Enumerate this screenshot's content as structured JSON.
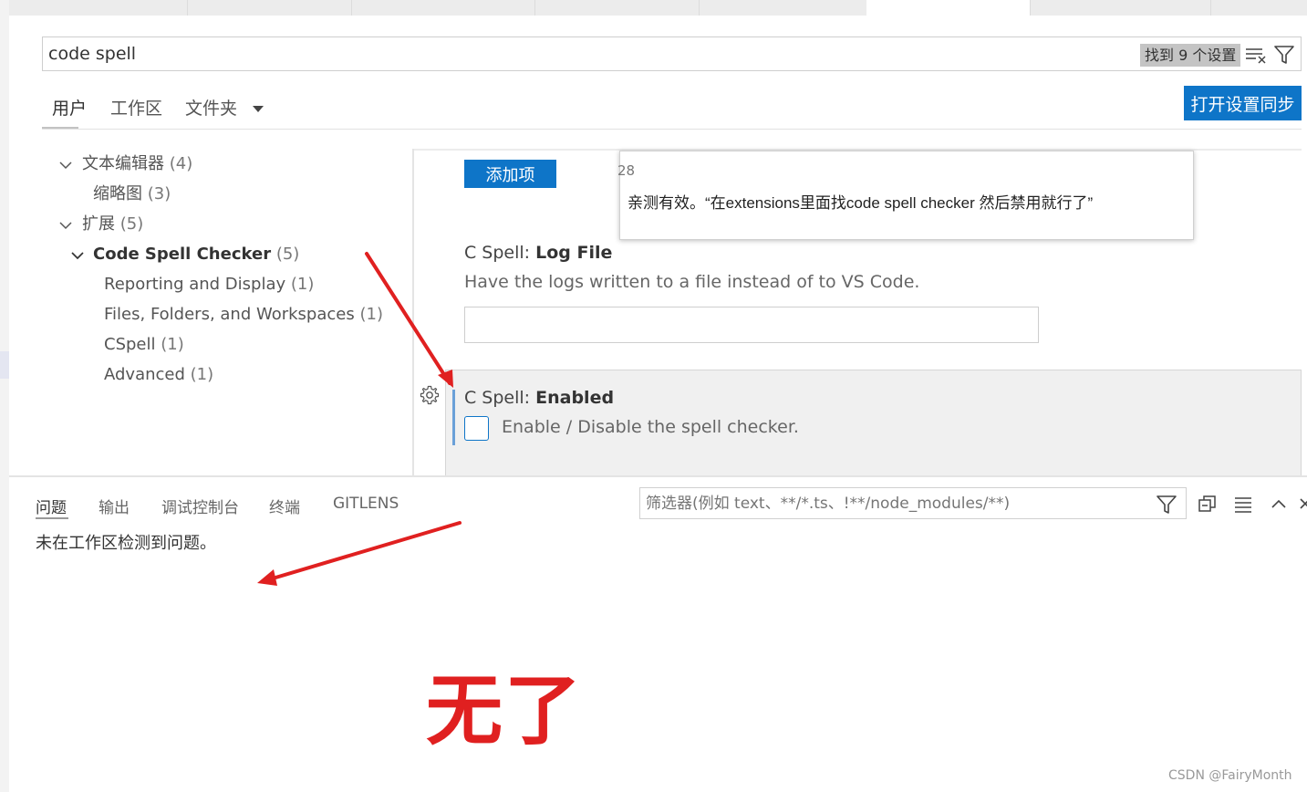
{
  "search": {
    "value": "code spell",
    "result_count": "找到 9 个设置"
  },
  "scope_tabs": [
    {
      "label": "用户",
      "active": true
    },
    {
      "label": "工作区",
      "active": false
    },
    {
      "label": "文件夹",
      "active": false
    }
  ],
  "sync_button": "打开设置同步",
  "toc": {
    "items": [
      {
        "label": "文本编辑器",
        "count": "(4)"
      },
      {
        "label": "缩略图",
        "count": "(3)"
      },
      {
        "label": "扩展",
        "count": "(5)"
      },
      {
        "label": "Code Spell Checker",
        "count": "(5)"
      },
      {
        "label": "Reporting and Display",
        "count": "(1)"
      },
      {
        "label": "Files, Folders, and Workspaces",
        "count": "(1)"
      },
      {
        "label": "CSpell",
        "count": "(1)"
      },
      {
        "label": "Advanced",
        "count": "(1)"
      }
    ]
  },
  "settings": {
    "add_item_button": "添加项",
    "log_file": {
      "category": "C Spell: ",
      "name": "Log File",
      "description": "Have the logs written to a file instead of to VS Code.",
      "value": ""
    },
    "enabled": {
      "category": "C Spell: ",
      "name": "Enabled",
      "description": "Enable / Disable the spell checker.",
      "checked": false
    }
  },
  "tooltip": {
    "fragment": "28",
    "text": "亲测有效。“在extensions里面找code spell checker 然后禁用就行了”"
  },
  "panel": {
    "tabs": [
      "问题",
      "输出",
      "调试控制台",
      "终端",
      "GITLENS"
    ],
    "filter_placeholder": "筛选器(例如 text、**/*.ts、!**/node_modules/**)",
    "message": "未在工作区检测到问题。"
  },
  "annotation": {
    "text": "无了",
    "color": "#e02020"
  },
  "watermark": "CSDN @FairyMonth",
  "colors": {
    "accent": "#0e75c8",
    "annotation_red": "#e02020"
  }
}
